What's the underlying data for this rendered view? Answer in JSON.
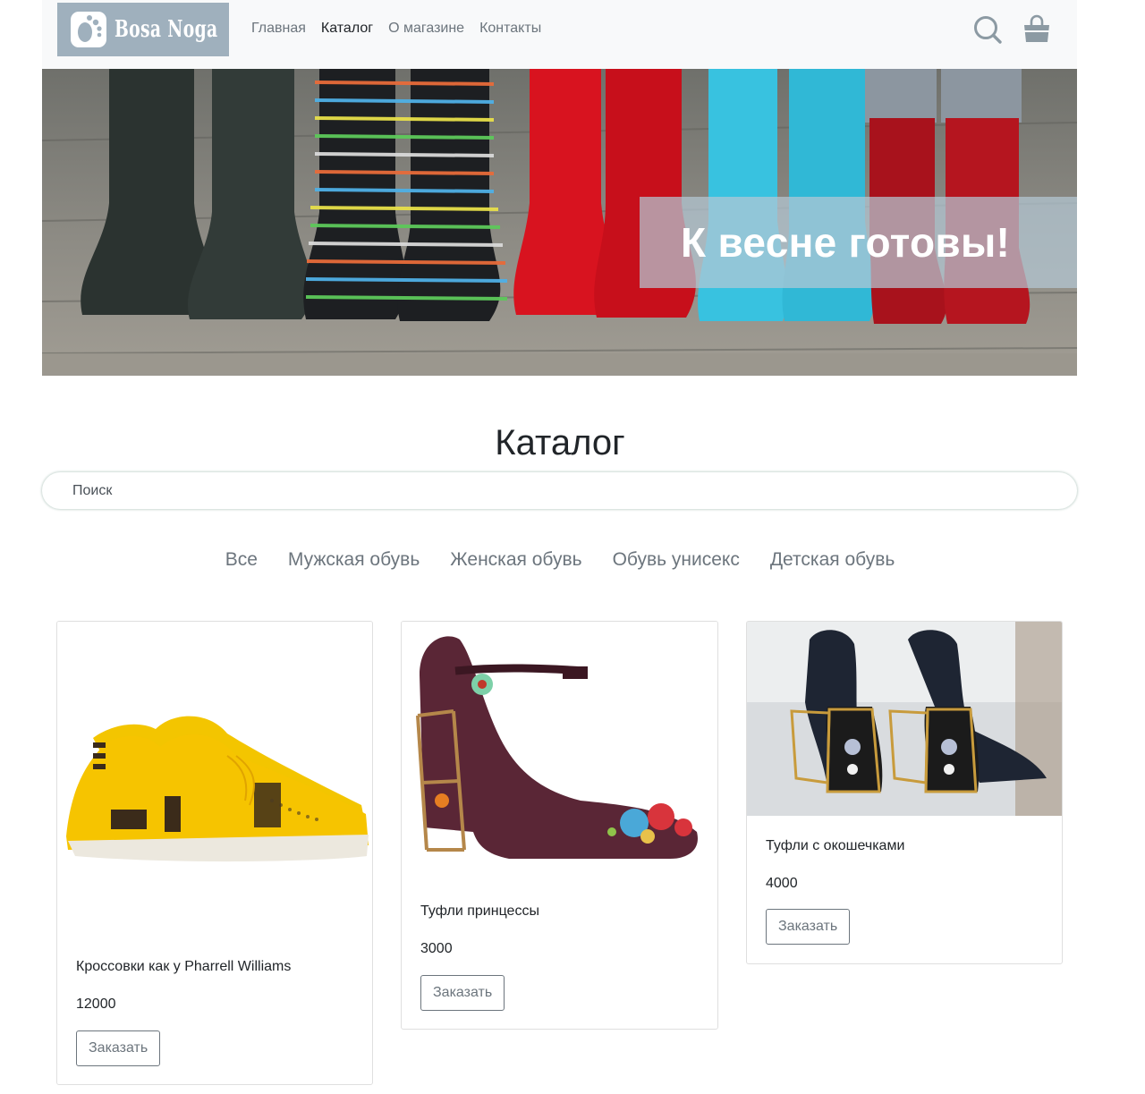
{
  "header": {
    "logo_text": "Bosa Noga",
    "nav": [
      {
        "label": "Главная",
        "active": false
      },
      {
        "label": "Каталог",
        "active": true
      },
      {
        "label": "О магазине",
        "active": false
      },
      {
        "label": "Контакты",
        "active": false
      }
    ],
    "search_icon": "search-icon",
    "cart_icon": "cart-icon"
  },
  "banner": {
    "caption": "К весне готовы!"
  },
  "catalog": {
    "title": "Каталог",
    "search_placeholder": "Поиск",
    "categories": [
      "Все",
      "Мужская обувь",
      "Женская обувь",
      "Обувь унисекс",
      "Детская обувь"
    ]
  },
  "products": [
    {
      "title": "Кроссовки как у Pharrell Williams",
      "price": "12000",
      "button": "Заказать"
    },
    {
      "title": "Туфли принцессы",
      "price": "3000",
      "button": "Заказать"
    },
    {
      "title": "Туфли с окошечками",
      "price": "4000",
      "button": "Заказать"
    }
  ],
  "colors": {
    "header_bg": "#f8f9fa",
    "logo_bg": "#9fb0bd",
    "caption_bg": "#b4c8d4",
    "muted": "#6c757d",
    "text": "#212529"
  }
}
